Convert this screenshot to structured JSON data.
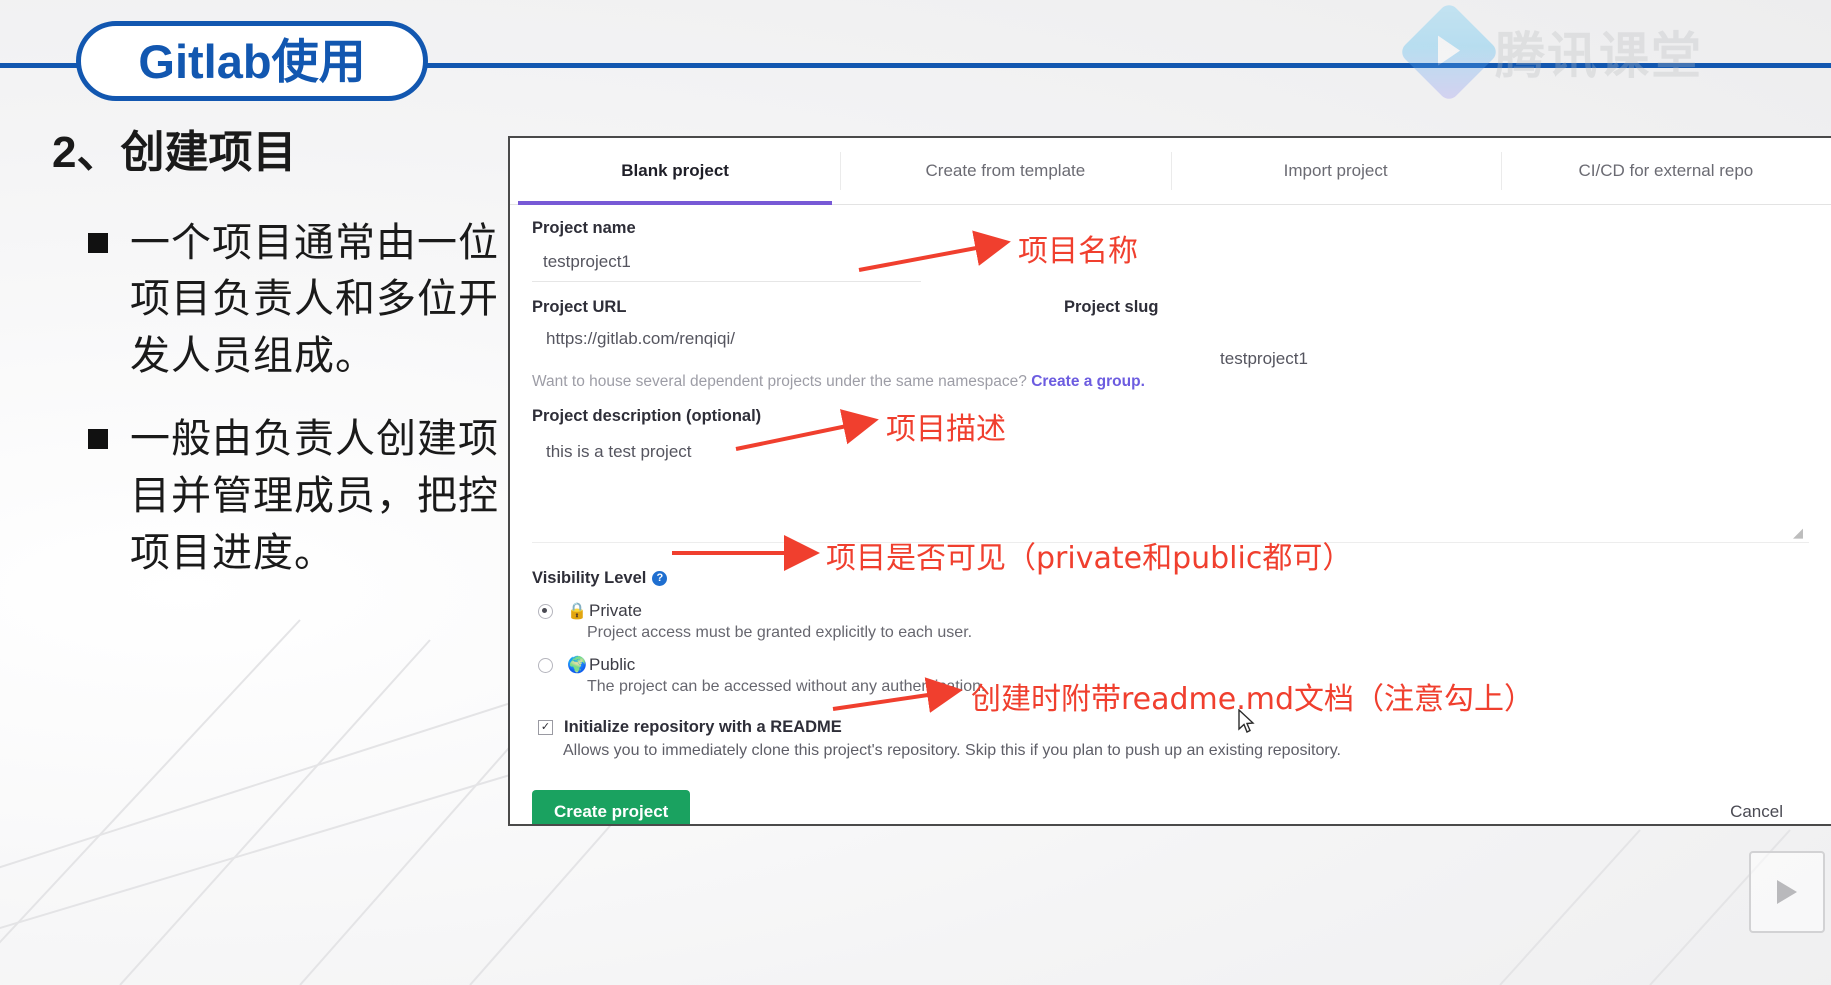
{
  "slide": {
    "title": "Gitlab使用",
    "watermark_text": "腾讯课堂",
    "section_heading": "2、创建项目",
    "bullets": [
      "一个项目通常由一位项目负责人和多位开发人员组成。",
      "一般由负责人创建项目并管理成员，把控项目进度。"
    ]
  },
  "gitlab": {
    "tabs": [
      {
        "label": "Blank project",
        "active": true
      },
      {
        "label": "Create from template",
        "active": false
      },
      {
        "label": "Import project",
        "active": false
      },
      {
        "label": "CI/CD for external repo",
        "active": false
      }
    ],
    "project_name": {
      "label": "Project name",
      "value": "testproject1"
    },
    "project_url": {
      "label": "Project URL",
      "value": "https://gitlab.com/renqiqi/"
    },
    "project_slug": {
      "label": "Project slug",
      "value": "testproject1"
    },
    "namespace_hint": {
      "text": "Want to house several dependent projects under the same namespace?",
      "link": "Create a group."
    },
    "project_description": {
      "label": "Project description (optional)",
      "value": "this is a test project"
    },
    "visibility": {
      "label": "Visibility Level",
      "help_icon": "question-mark",
      "options": [
        {
          "name": "Private",
          "icon": "lock-icon",
          "glyph": "🔒",
          "description": "Project access must be granted explicitly to each user.",
          "selected": true
        },
        {
          "name": "Public",
          "icon": "globe-icon",
          "glyph": "🌍",
          "description": "The project can be accessed without any authentication.",
          "selected": false
        }
      ]
    },
    "readme": {
      "label": "Initialize repository with a README",
      "description": "Allows you to immediately clone this project's repository. Skip this if you plan to push up an existing repository.",
      "checked": true,
      "check_glyph": "✓"
    },
    "create_button": "Create project",
    "cancel_button": "Cancel"
  },
  "annotations": [
    {
      "id": "name",
      "text": "项目名称"
    },
    {
      "id": "desc",
      "text": "项目描述"
    },
    {
      "id": "vis",
      "text": "项目是否可见（private和public都可）"
    },
    {
      "id": "readme",
      "text": "创建时附带readme.md文档（注意勾上）"
    }
  ],
  "colors": {
    "brand_blue": "#1257b0",
    "annotation_red": "#f03f2e",
    "tab_accent": "#7759d6",
    "link_purple": "#6c5ce0",
    "create_green": "#1aa260"
  }
}
